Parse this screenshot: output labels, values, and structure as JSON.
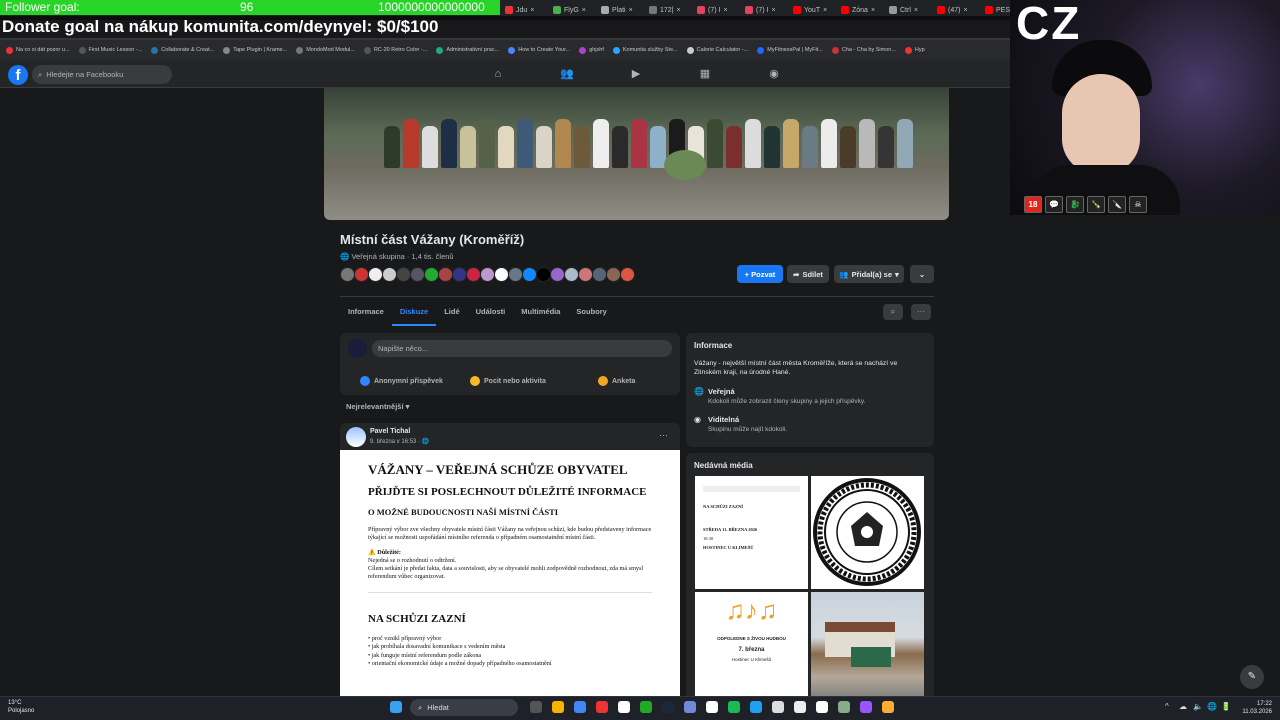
{
  "overlay": {
    "follower_goal_label": "Follower goal:",
    "follower_current": "96",
    "follower_target": "1000000000000000",
    "donate_text": "Donate goal na nákup komunita.com/deynyel: $0/$100",
    "cam_text": "CZ"
  },
  "browser": {
    "tabs": [
      "Jdu",
      "FlyG",
      "Plati",
      "172|",
      "(7) I",
      "(7) I",
      "YouT",
      "Zóna",
      "Ctrl",
      "(47)",
      "PES"
    ],
    "bookmarks": [
      "Na co si dát pozor u...",
      "First Music Lesson -...",
      "Collaborate & Creat...",
      "Tape Plugin | Krame...",
      "MondoMod Modul...",
      "RC-20 Retro Color -...",
      "Administrativní prac...",
      "How to Create Your...",
      "ghjshf",
      "Komunita služby Ste...",
      "Calorie Calculator -...",
      "MyFitnessPal | MyFit...",
      "Cha - Cha by Simon...",
      "Hyp"
    ]
  },
  "facebook": {
    "logo": "f",
    "search_placeholder": "Hledejte na Facebooku",
    "group": {
      "name": "Místní část Vážany (Kroměříž)",
      "meta": "Veřejná skupina · 1,4 tis. členů",
      "invite_label": "+ Pozvat",
      "share_label": "Sdílet",
      "joined_label": "Přidal(a) se",
      "tabs": [
        "Informace",
        "Diskuze",
        "Lidé",
        "Události",
        "Multimédia",
        "Soubory"
      ],
      "active_tab": "Diskuze"
    },
    "composer": {
      "placeholder": "Napište něco...",
      "actions": [
        "Anonymní příspěvek",
        "Pocit nebo aktivita",
        "Anketa"
      ]
    },
    "sort_label": "Nejrelevantnější",
    "post": {
      "author": "Pavel Tichal",
      "time": "9. března v 16:53 · ",
      "doc_title": "VÁŽANY – VEŘEJNÁ SCHŮZE OBYVATEL",
      "doc_sub": "PŘIJĎTE SI POSLECHNOUT DŮLEŽITÉ INFORMACE",
      "doc_h3": "O MOŽNÉ BUDOUCNOSTI NAŠÍ MÍSTNÍ ČÁSTI",
      "doc_p1": "Přípravný výbor zve všechny obyvatele místní části Vážany na veřejnou schůzi, kde budou představeny informace týkající se možnosti uspořádání místního referenda o případném osamostatnění místní části.",
      "doc_important": "⚠️ Důležité:",
      "doc_p2a": "Nejedná se o rozhodnutí o odtržení.",
      "doc_p2b": "Cílem setkání je předat fakta, data a souvislosti, aby se obyvatelé mohli zodpovědně rozhodnout, zda má smysl referendum vůbec organizovat.",
      "doc_h4": "NA SCHŮZI ZAZNÍ",
      "doc_list": [
        "• proč vznikl přípravný výbor",
        "• jak probíhala dosavadní komunikace s vedením města",
        "• jak funguje místní referendum podle zákona",
        "• orientační ekonomické údaje a možné dopady případného osamostatnění"
      ]
    },
    "info": {
      "title": "Informace",
      "desc": "Vážany - největší místní část města Kroměříže, která se nachází ve Zlínském kraji, na úrodné Hané.",
      "public_title": "Veřejná",
      "public_desc": "Kdokoli může zobrazit členy skupiny a jejich příspěvky.",
      "visible_title": "Viditelná",
      "visible_desc": "Skupinu může najít kdokoli."
    },
    "media": {
      "title": "Nedávná média",
      "poster1_lines": [
        "NA SCHŮZI ZAZNÍ",
        "STŘEDA 11. BŘEZNA 2026",
        "18:30",
        "HOSTINEC U KLIMEŠŮ"
      ],
      "poster2_lines": [
        "ODPOLEDNE S ŽIVOU HUDBOU",
        "7. března",
        "Hostinec U Klimešů"
      ]
    }
  },
  "taskbar": {
    "weather_temp": "13°C",
    "weather_desc": "Polojasno",
    "search_placeholder": "Hledat",
    "time": "17:22",
    "date": "11.03.2026"
  },
  "badges": [
    "18",
    "💬",
    "🐉",
    "🍾",
    "🔪",
    "☠"
  ],
  "colors": {
    "fb_blue": "#1877f2",
    "goal_green": "#28d428",
    "link_blue": "#2d88ff"
  }
}
